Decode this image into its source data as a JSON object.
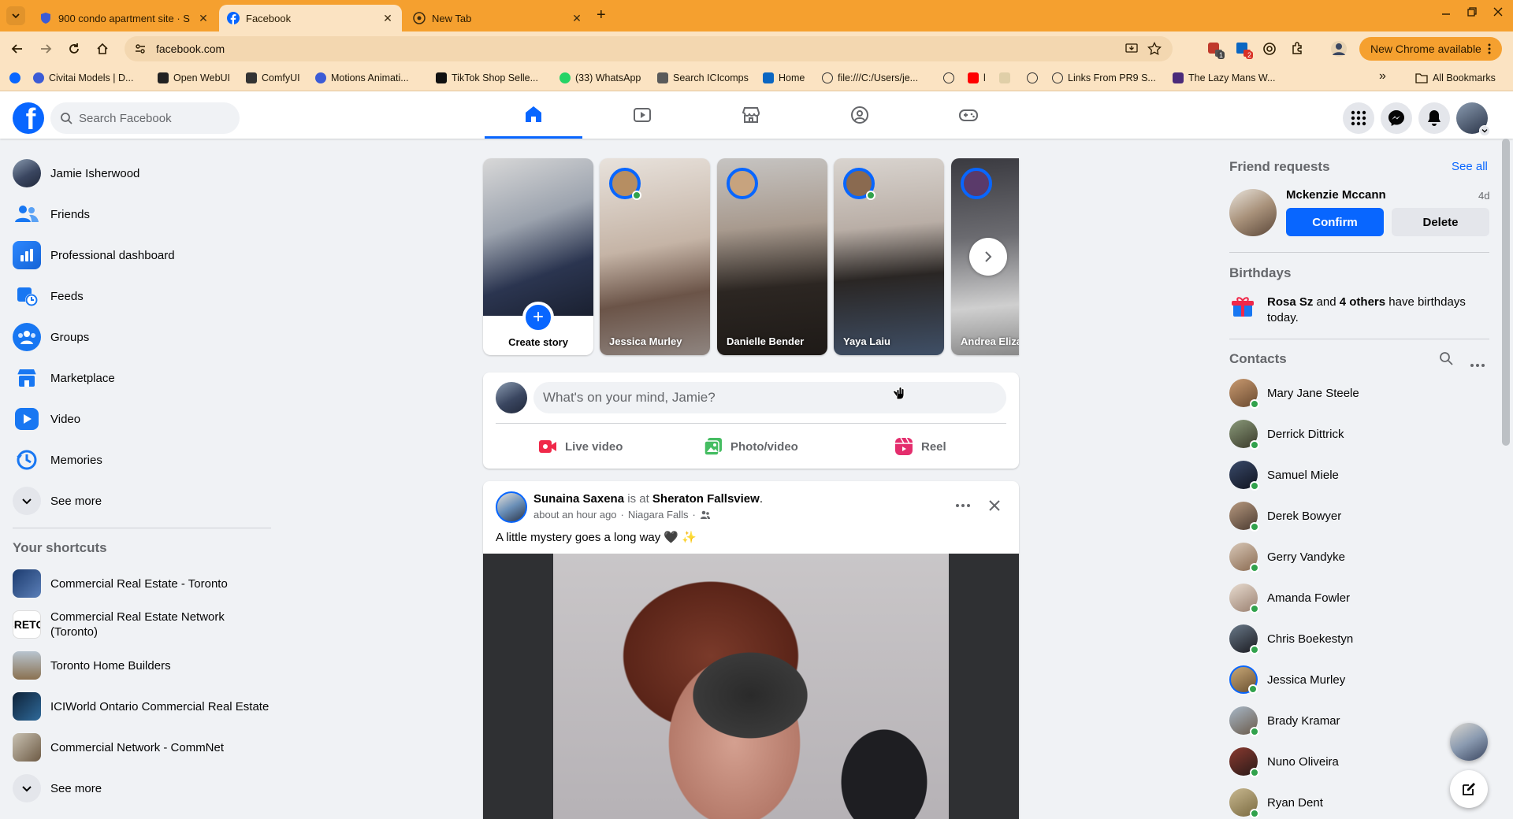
{
  "browser": {
    "tabs": [
      {
        "title": "900 condo apartment site · S",
        "close": "✕"
      },
      {
        "title": "Facebook",
        "close": "✕"
      },
      {
        "title": "New Tab",
        "close": "✕"
      }
    ],
    "new_tab": "+",
    "url": "facebook.com",
    "update_label": "New Chrome available",
    "bookmarks": [
      "Civitai Models | D...",
      "Open WebUI",
      "ComfyUI",
      "Motions Animati...",
      "TikTok Shop Selle...",
      "(33) WhatsApp",
      "Search ICIcomps",
      "Home",
      "file:///C:/Users/je...",
      "l",
      "Links From PR9 S...",
      "The Lazy Mans W..."
    ],
    "bookmarks_overflow": "»",
    "all_bookmarks": "All Bookmarks",
    "extension_badges": [
      "1",
      "2"
    ]
  },
  "header": {
    "logo": "f",
    "search_placeholder": "Search Facebook"
  },
  "left_nav": {
    "items": [
      "Jamie Isherwood",
      "Friends",
      "Professional dashboard",
      "Feeds",
      "Groups",
      "Marketplace",
      "Video",
      "Memories",
      "See more"
    ],
    "shortcuts_title": "Your shortcuts",
    "shortcuts": [
      "Commercial Real Estate - Toronto",
      "Commercial Real Estate Network (Toronto)",
      "Toronto Home Builders",
      "ICIWorld Ontario Commercial Real Estate",
      "Commercial Network - CommNet",
      "See more"
    ],
    "shortcut_thumb_text": [
      "CRETO"
    ]
  },
  "stories": {
    "create_label": "Create story",
    "create_plus": "+",
    "items": [
      "Jessica Murley",
      "Danielle Bender",
      "Yaya Laiu",
      "Andrea Eliza"
    ]
  },
  "composer": {
    "placeholder": "What's on your mind, Jamie?",
    "actions": [
      "Live video",
      "Photo/video",
      "Reel"
    ]
  },
  "post": {
    "author": "Sunaina Saxena",
    "is_at": "is at",
    "place": "Sheraton Fallsview",
    "period": ".",
    "time": "about an hour ago",
    "sep": "·",
    "location": "Niagara Falls",
    "text": "A little mystery goes a long way 🖤 ✨"
  },
  "friend_requests": {
    "title": "Friend requests",
    "see_all": "See all",
    "name": "Mckenzie Mccann",
    "age": "4d",
    "confirm": "Confirm",
    "delete": "Delete"
  },
  "birthdays": {
    "title": "Birthdays",
    "name": "Rosa Sz",
    "and": "and",
    "others": "4 others",
    "rest": "have birthdays today."
  },
  "contacts": {
    "title": "Contacts",
    "list": [
      "Mary Jane Steele",
      "Derrick Dittrick",
      "Samuel Miele",
      "Derek Bowyer",
      "Gerry Vandyke",
      "Amanda Fowler",
      "Chris Boekestyn",
      "Jessica Murley",
      "Brady Kramar",
      "Nuno Oliveira",
      "Ryan Dent"
    ]
  },
  "colors": {
    "chrome_tabbar": "#f5a02f",
    "chrome_toolbar": "#fbe3c2",
    "fb_blue": "#0866ff",
    "online_green": "#31a24c"
  }
}
